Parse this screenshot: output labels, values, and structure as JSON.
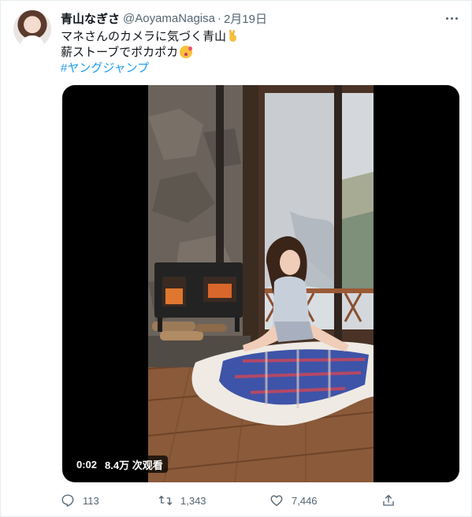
{
  "tweet": {
    "display_name": "青山なぎさ",
    "handle": "@AoyamaNagisa",
    "separator": "·",
    "date": "2月19日",
    "lines": [
      "マネさんのカメラに気づく青山",
      "薪ストーブでポカポカ"
    ],
    "hashtag": "#ヤングジャンプ"
  },
  "video": {
    "duration": "0:02",
    "views": "8.4万 次观看"
  },
  "actions": {
    "replies": "113",
    "retweets": "1,343",
    "likes": "7,446"
  },
  "icons": {
    "avatar": "avatar",
    "more": "more-icon",
    "reply": "reply-icon",
    "retweet": "retweet-icon",
    "like": "heart-icon",
    "share": "share-icon",
    "emoji1": "victory-hand-emoji",
    "emoji2": "kiss-emoji"
  },
  "colors": {
    "link": "#1d9bf0",
    "muted": "#536471",
    "text": "#0f1419"
  }
}
